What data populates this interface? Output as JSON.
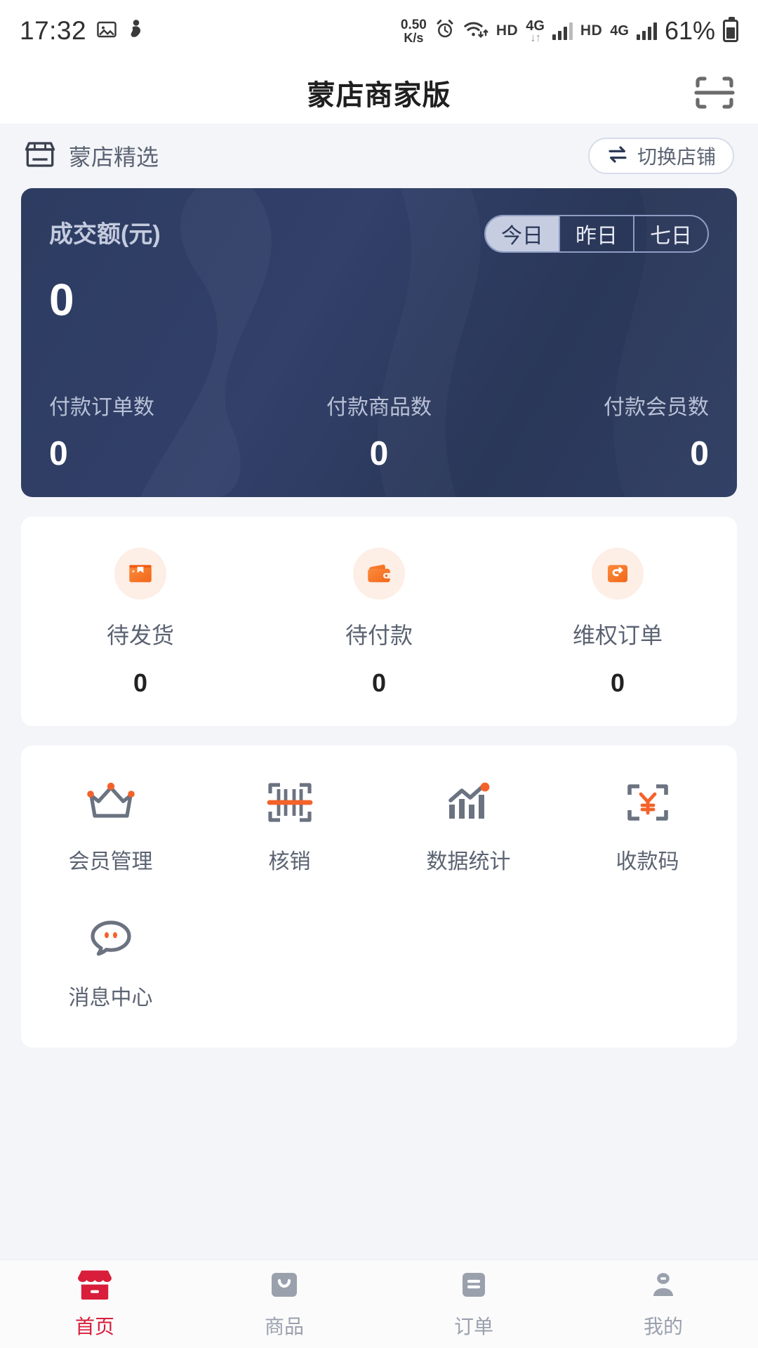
{
  "statusbar": {
    "time": "17:32",
    "photo_icon": "image-icon",
    "app_icon": "app-icon",
    "netspeed_value": "0.50",
    "netspeed_unit": "K/s",
    "alarm_icon": "alarm-icon",
    "wifi_icon": "wifi-icon",
    "hd_label_1": "HD",
    "network_type_1": "4G",
    "hd_label_2": "HD",
    "network_type_2": "4G",
    "battery_percent": "61%",
    "battery_icon": "battery-icon"
  },
  "header": {
    "title": "蒙店商家版",
    "scan_icon": "scan-icon"
  },
  "shop": {
    "store_icon": "store-icon",
    "name": "蒙店精选",
    "switch_icon": "swap-icon",
    "switch_label": "切换店铺"
  },
  "revenue": {
    "label": "成交额(元)",
    "value": "0",
    "tabs": [
      {
        "label": "今日",
        "active": true
      },
      {
        "label": "昨日",
        "active": false
      },
      {
        "label": "七日",
        "active": false
      }
    ],
    "stats": [
      {
        "label": "付款订单数",
        "value": "0"
      },
      {
        "label": "付款商品数",
        "value": "0"
      },
      {
        "label": "付款会员数",
        "value": "0"
      }
    ]
  },
  "orders": [
    {
      "icon": "package-icon",
      "label": "待发货",
      "value": "0"
    },
    {
      "icon": "wallet-icon",
      "label": "待付款",
      "value": "0"
    },
    {
      "icon": "refund-icon",
      "label": "维权订单",
      "value": "0"
    }
  ],
  "functions": [
    {
      "icon": "crown-icon",
      "label": "会员管理"
    },
    {
      "icon": "barcode-icon",
      "label": "核销"
    },
    {
      "icon": "chart-icon",
      "label": "数据统计"
    },
    {
      "icon": "payment-qr-icon",
      "label": "收款码"
    },
    {
      "icon": "message-icon",
      "label": "消息中心"
    }
  ],
  "tabbar": [
    {
      "icon": "home-store-icon",
      "label": "首页",
      "active": true
    },
    {
      "icon": "bag-icon",
      "label": "商品",
      "active": false
    },
    {
      "icon": "order-list-icon",
      "label": "订单",
      "active": false
    },
    {
      "icon": "person-icon",
      "label": "我的",
      "active": false
    }
  ],
  "colors": {
    "accent_red": "#d81e3a",
    "accent_orange": "#f4762a",
    "card_dark": "#2d3c61",
    "page_bg": "#f4f5f9",
    "text_muted": "#5b6372"
  }
}
